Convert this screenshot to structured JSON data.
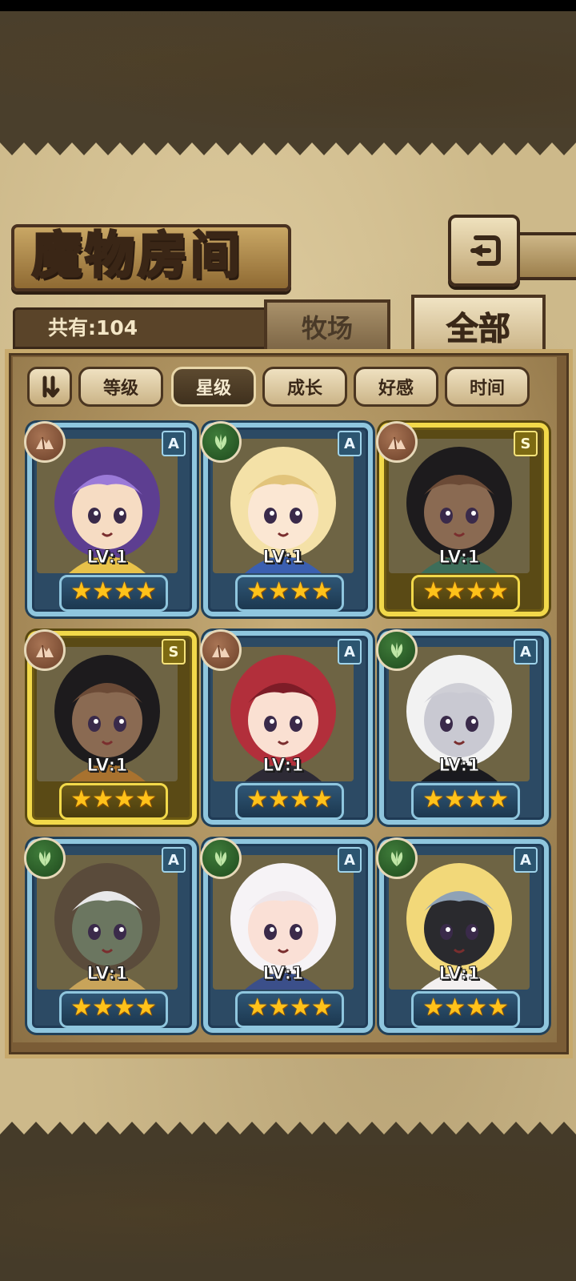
{
  "title": "魔物房间",
  "count_label": "共有:104",
  "tabs": [
    {
      "label": "牧场",
      "active": false
    },
    {
      "label": "全部",
      "active": true
    }
  ],
  "sort_toggle_icon": "sort-order-icon",
  "sort_buttons": [
    {
      "label": "等级",
      "active": false
    },
    {
      "label": "星级",
      "active": true
    },
    {
      "label": "成长",
      "active": false
    },
    {
      "label": "好感",
      "active": false
    },
    {
      "label": "时间",
      "active": false
    }
  ],
  "cards": [
    {
      "rank": "A",
      "element": "earth",
      "level": "LV:1",
      "stars": 4,
      "frame": "blue",
      "palette": [
        "#5d3e91",
        "#9b7ad8",
        "#f6dcc3",
        "#e8c24a"
      ]
    },
    {
      "rank": "A",
      "element": "wood",
      "level": "LV:1",
      "stars": 4,
      "frame": "blue",
      "palette": [
        "#f4e1a7",
        "#e2c47b",
        "#fbe7d3",
        "#3b5fb0"
      ]
    },
    {
      "rank": "S",
      "element": "earth",
      "level": "LV:1",
      "stars": 4,
      "frame": "gold",
      "palette": [
        "#1d1b1d",
        "#6b4a36",
        "#8a6a52",
        "#3d6e5a"
      ]
    },
    {
      "rank": "S",
      "element": "earth",
      "level": "LV:1",
      "stars": 4,
      "frame": "gold",
      "palette": [
        "#1d1b1d",
        "#6b4a36",
        "#8a6a52",
        "#a8722f"
      ]
    },
    {
      "rank": "A",
      "element": "earth",
      "level": "LV:1",
      "stars": 4,
      "frame": "blue",
      "palette": [
        "#b22f3b",
        "#7d1c27",
        "#fae0d2",
        "#2d2a35"
      ]
    },
    {
      "rank": "A",
      "element": "wood",
      "level": "LV:1",
      "stars": 4,
      "frame": "blue",
      "palette": [
        "#f2f2f2",
        "#cfcfd6",
        "#c9c9d2",
        "#1a1a1f"
      ]
    },
    {
      "rank": "A",
      "element": "wood",
      "level": "LV:1",
      "stars": 4,
      "frame": "blue",
      "palette": [
        "#5a4b3b",
        "#e8e8ea",
        "#6b7660",
        "#c8a45a"
      ]
    },
    {
      "rank": "A",
      "element": "wood",
      "level": "LV:1",
      "stars": 4,
      "frame": "blue",
      "palette": [
        "#f6f3f6",
        "#eee6ea",
        "#fae0d6",
        "#3b4f8a"
      ]
    },
    {
      "rank": "A",
      "element": "wood",
      "level": "LV:1",
      "stars": 4,
      "frame": "blue",
      "palette": [
        "#f2d879",
        "#8fa2b6",
        "#2a2a2e",
        "#f3f0f0"
      ]
    }
  ]
}
